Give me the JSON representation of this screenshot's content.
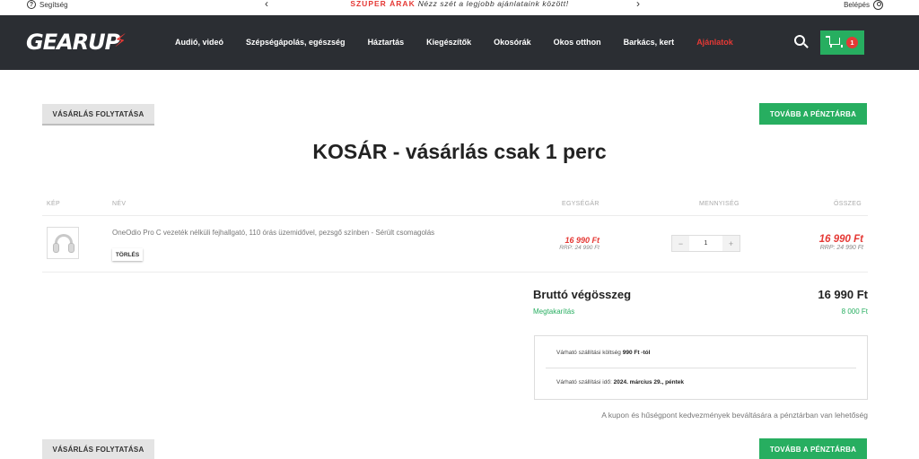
{
  "topbar": {
    "help_label": "Segítség",
    "help_icon": "question-icon",
    "promo_highlight": "SZUPER ÁRAK",
    "promo_text": "Nézz szét a legjobb ajánlataink között!",
    "prev_arrow": "‹",
    "next_arrow": "›",
    "login_label": "Belépés"
  },
  "header": {
    "logo_text": "GEARU",
    "logo_suffix": "P",
    "menu": [
      {
        "label": "Audió, videó"
      },
      {
        "label": "Szépségápolás, egészség"
      },
      {
        "label": "Háztartás"
      },
      {
        "label": "Kiegészítők"
      },
      {
        "label": "Okosórák"
      },
      {
        "label": "Okos otthon"
      },
      {
        "label": "Barkács, kert"
      },
      {
        "label": "Ajánlatok"
      }
    ],
    "cart_count": "1"
  },
  "actions": {
    "continue_label": "VÁSÁRLÁS FOLYTATÁSA",
    "checkout_label": "TOVÁBB A PÉNZTÁRBA"
  },
  "page": {
    "title": "KOSÁR - vásárlás csak 1 perc"
  },
  "table": {
    "headers": {
      "image": "KÉP",
      "name": "NÉV",
      "unit_price": "EGYSÉGÁR",
      "quantity": "MENNYISÉG",
      "total": "ÖSSZEG"
    },
    "rows": [
      {
        "name": "OneOdio Pro C vezeték nélküli fejhallgató, 110 órás üzemidővel, pezsgő színben - Sérült csomagolás",
        "delete_label": "TÖRLÉS",
        "unit_price": "16 990 Ft",
        "unit_rrp": "RRP: 24 990 Ft",
        "quantity": "1",
        "minus": "−",
        "plus": "+",
        "total": "16 990 Ft",
        "total_rrp": "RRP: 24 990 Ft"
      }
    ]
  },
  "summary": {
    "gross_label": "Bruttó végösszeg",
    "gross_value": "16 990 Ft",
    "saving_label": "Megtakarítás",
    "saving_value": "8 000 Ft",
    "shipping_cost_prefix": "Várható szállítási költség",
    "shipping_cost_value": "990 Ft -tól",
    "shipping_time_prefix": "Várható szállítási idő:",
    "shipping_time_value": "2024. március 29., péntek",
    "coupon_note": "A kupon és hűségpont kedvezmények beváltására a pénztárban van lehetőség"
  },
  "colors": {
    "accent_green": "#27ae60",
    "accent_red": "#e53935",
    "nav_bg": "#2b2e33"
  }
}
